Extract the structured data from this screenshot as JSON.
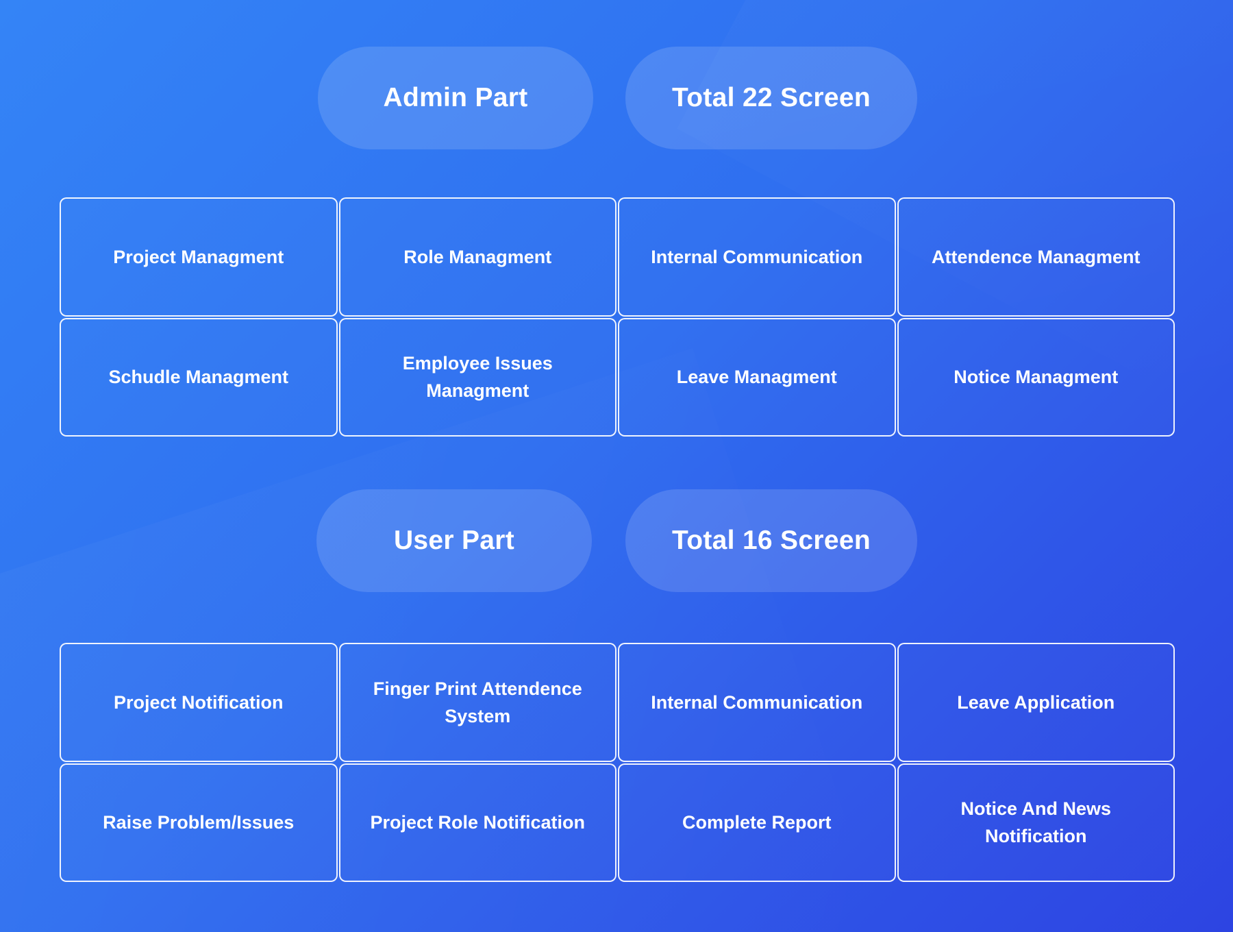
{
  "colors": {
    "background_start": "#3484f6",
    "background_end": "#2d44e2",
    "pill_fill": "rgba(255,255,255,0.14)",
    "cell_border": "#ffffff",
    "text": "#ffffff"
  },
  "admin": {
    "title": "Admin Part",
    "total": "Total 22 Screen",
    "items": [
      "Project Managment",
      "Role Managment",
      "Internal Communication",
      "Attendence Managment",
      "Schudle Managment",
      "Employee Issues Managment",
      "Leave Managment",
      "Notice Managment"
    ]
  },
  "user": {
    "title": "User Part",
    "total": "Total 16 Screen",
    "items": [
      "Project Notification",
      "Finger Print Attendence System",
      "Internal Communication",
      "Leave Application",
      "Raise Problem/Issues",
      "Project Role Notification",
      "Complete Report",
      "Notice And News Notification"
    ]
  }
}
